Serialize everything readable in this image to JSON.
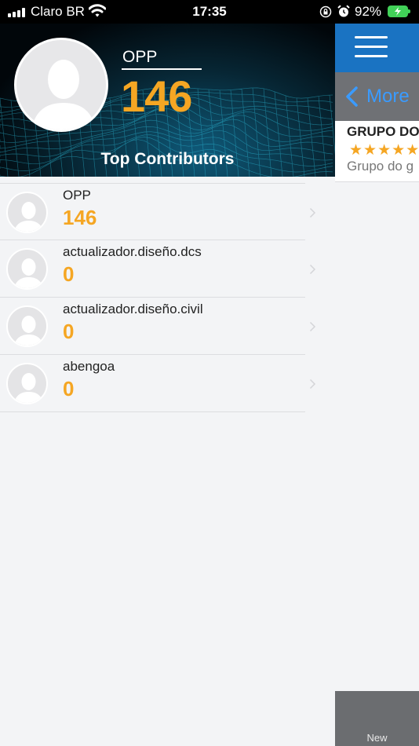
{
  "status_bar": {
    "carrier": "Claro BR",
    "time": "17:35",
    "battery": "92%"
  },
  "header": {
    "name": "OPP",
    "score": "146",
    "caption": "Top Contributors"
  },
  "contributors": [
    {
      "name": "OPP",
      "score": "146"
    },
    {
      "name": "actualizador.diseño.dcs",
      "score": "0"
    },
    {
      "name": "actualizador.diseño.civil",
      "score": "0"
    },
    {
      "name": "abengoa",
      "score": "0"
    }
  ],
  "side_panel": {
    "back_label": "More",
    "card_title": "GRUPO DO",
    "rating_stars": "★★★★★",
    "card_desc": "Grupo do g",
    "bottom_tab": "New"
  },
  "icons": [
    "signal-icon",
    "wifi-icon",
    "orientation-lock-icon",
    "alarm-icon",
    "battery-icon",
    "avatar-placeholder-icon",
    "chevron-right-icon",
    "menu-icon",
    "chevron-left-icon",
    "star-icon"
  ],
  "colors": {
    "accent": "#f5a623",
    "link": "#3a9bff",
    "topbar": "#1a73c2",
    "navbar": "#6f7175",
    "battery": "#41d158"
  }
}
